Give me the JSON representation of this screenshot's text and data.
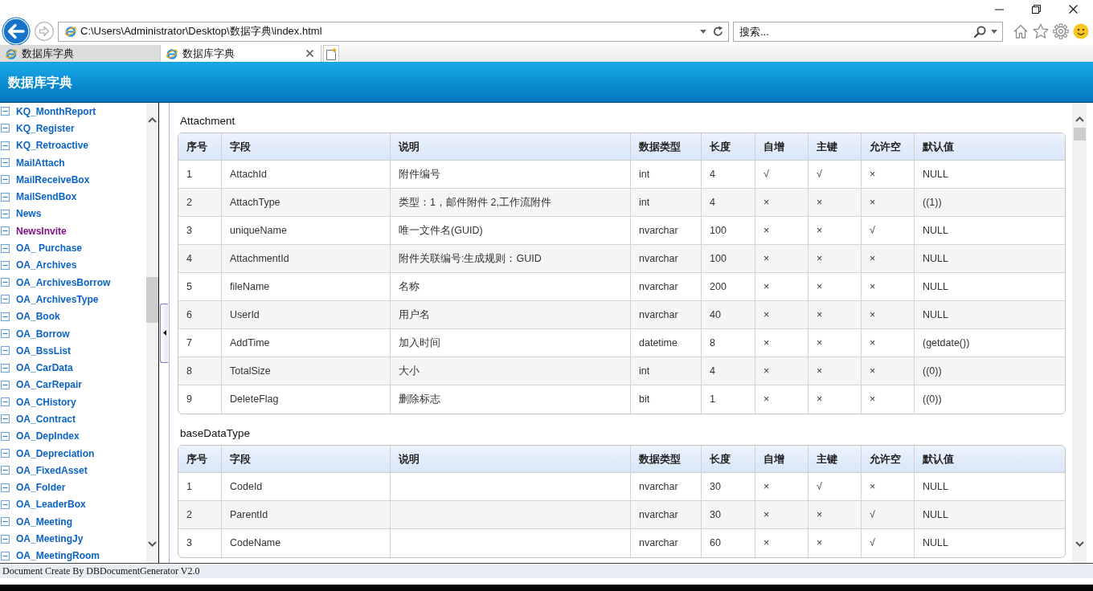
{
  "browser": {
    "address": "C:\\Users\\Administrator\\Desktop\\数据字典\\index.html",
    "search": {
      "placeholder": "搜索..."
    },
    "tabs": [
      {
        "label": "数据库字典",
        "selected": false
      },
      {
        "label": "数据库字典",
        "selected": true
      }
    ]
  },
  "header": {
    "title": "数据库字典"
  },
  "sidebar": {
    "items": [
      {
        "label": "KQ_MonthReport",
        "visited": false
      },
      {
        "label": "KQ_Register",
        "visited": false
      },
      {
        "label": "KQ_Retroactive",
        "visited": false
      },
      {
        "label": "MailAttach",
        "visited": false
      },
      {
        "label": "MailReceiveBox",
        "visited": false
      },
      {
        "label": "MailSendBox",
        "visited": false
      },
      {
        "label": "News",
        "visited": false
      },
      {
        "label": "NewsInvite",
        "visited": true
      },
      {
        "label": "OA_ Purchase",
        "visited": false
      },
      {
        "label": "OA_Archives",
        "visited": false
      },
      {
        "label": "OA_ArchivesBorrow",
        "visited": false
      },
      {
        "label": "OA_ArchivesType",
        "visited": false
      },
      {
        "label": "OA_Book",
        "visited": false
      },
      {
        "label": "OA_Borrow",
        "visited": false
      },
      {
        "label": "OA_BssList",
        "visited": false
      },
      {
        "label": "OA_CarData",
        "visited": false
      },
      {
        "label": "OA_CarRepair",
        "visited": false
      },
      {
        "label": "OA_CHistory",
        "visited": false
      },
      {
        "label": "OA_Contract",
        "visited": false
      },
      {
        "label": "OA_DepIndex",
        "visited": false
      },
      {
        "label": "OA_Depreciation",
        "visited": false
      },
      {
        "label": "OA_FixedAsset",
        "visited": false
      },
      {
        "label": "OA_Folder",
        "visited": false
      },
      {
        "label": "OA_LeaderBox",
        "visited": false
      },
      {
        "label": "OA_Meeting",
        "visited": false
      },
      {
        "label": "OA_MeetingJy",
        "visited": false
      },
      {
        "label": "OA_MeetingRoom",
        "visited": false
      }
    ]
  },
  "tables": [
    {
      "name": "Attachment",
      "columns": [
        "序号",
        "字段",
        "说明",
        "数据类型",
        "长度",
        "自增",
        "主键",
        "允许空",
        "默认值"
      ],
      "rows": [
        {
          "seq": "1",
          "field": "AttachId",
          "description": "附件编号",
          "data_type": "int",
          "length": "4",
          "identity": "√",
          "primary_key": "√",
          "nullable": "×",
          "default": "NULL"
        },
        {
          "seq": "2",
          "field": "AttachType",
          "description": "类型：1，邮件附件 2,工作流附件",
          "data_type": "int",
          "length": "4",
          "identity": "×",
          "primary_key": "×",
          "nullable": "×",
          "default": "((1))"
        },
        {
          "seq": "3",
          "field": "uniqueName",
          "description": "唯一文件名(GUID)",
          "data_type": "nvarchar",
          "length": "100",
          "identity": "×",
          "primary_key": "×",
          "nullable": "√",
          "default": "NULL"
        },
        {
          "seq": "4",
          "field": "AttachmentId",
          "description": "附件关联编号:生成规则：GUID",
          "data_type": "nvarchar",
          "length": "100",
          "identity": "×",
          "primary_key": "×",
          "nullable": "×",
          "default": "NULL"
        },
        {
          "seq": "5",
          "field": "fileName",
          "description": "名称",
          "data_type": "nvarchar",
          "length": "200",
          "identity": "×",
          "primary_key": "×",
          "nullable": "×",
          "default": "NULL"
        },
        {
          "seq": "6",
          "field": "UserId",
          "description": "用户名",
          "data_type": "nvarchar",
          "length": "40",
          "identity": "×",
          "primary_key": "×",
          "nullable": "×",
          "default": "NULL"
        },
        {
          "seq": "7",
          "field": "AddTime",
          "description": "加入时间",
          "data_type": "datetime",
          "length": "8",
          "identity": "×",
          "primary_key": "×",
          "nullable": "×",
          "default": "(getdate())"
        },
        {
          "seq": "8",
          "field": "TotalSize",
          "description": "大小",
          "data_type": "int",
          "length": "4",
          "identity": "×",
          "primary_key": "×",
          "nullable": "×",
          "default": "((0))"
        },
        {
          "seq": "9",
          "field": "DeleteFlag",
          "description": "删除标志",
          "data_type": "bit",
          "length": "1",
          "identity": "×",
          "primary_key": "×",
          "nullable": "×",
          "default": "((0))"
        }
      ]
    },
    {
      "name": "baseDataType",
      "columns": [
        "序号",
        "字段",
        "说明",
        "数据类型",
        "长度",
        "自增",
        "主键",
        "允许空",
        "默认值"
      ],
      "rows": [
        {
          "seq": "1",
          "field": "CodeId",
          "data_type": "nvarchar",
          "length": "30",
          "identity": "×",
          "primary_key": "√",
          "nullable": "×",
          "default": "NULL"
        },
        {
          "seq": "2",
          "field": "ParentId",
          "data_type": "nvarchar",
          "length": "30",
          "identity": "×",
          "primary_key": "×",
          "nullable": "√",
          "default": "NULL"
        },
        {
          "seq": "3",
          "field": "CodeName",
          "data_type": "nvarchar",
          "length": "60",
          "identity": "×",
          "primary_key": "×",
          "nullable": "√",
          "default": "NULL"
        }
      ]
    }
  ],
  "footer": {
    "text": "Document Create By DBDocumentGenerator V2.0"
  }
}
